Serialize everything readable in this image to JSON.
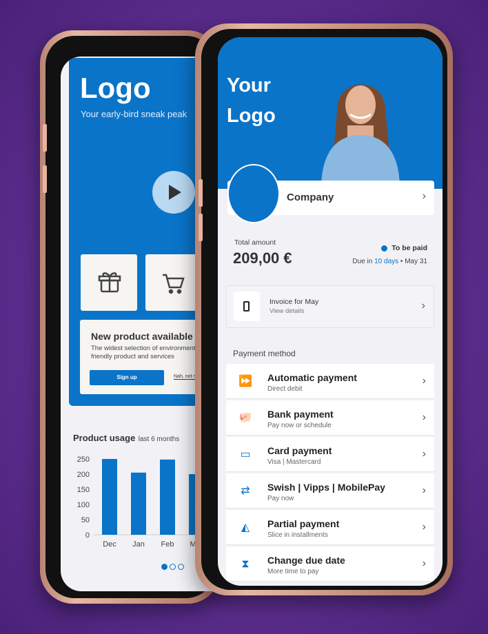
{
  "left_phone": {
    "logo": "Logo",
    "tagline": "Your early-bird sneak peak",
    "tiles": [
      {
        "icon": "gift-icon"
      },
      {
        "icon": "cart-icon"
      }
    ],
    "promo": {
      "title": "New product available",
      "body1": "The widest selection of environmentally",
      "body2": "friendly product and services",
      "primary": "Sign up",
      "secondary": "Nah, not now"
    },
    "usage_title": "Product usage",
    "usage_sub": "last 6 months",
    "pager": {
      "count": 3,
      "active": 0
    }
  },
  "chart_data": {
    "type": "bar",
    "title": "Product usage",
    "subtitle": "last 6 months",
    "categories": [
      "Dec",
      "Jan",
      "Feb",
      "Mar"
    ],
    "values": [
      250,
      205,
      248,
      200
    ],
    "ylim": [
      0,
      250
    ],
    "yticks": [
      250,
      200,
      150,
      100,
      50,
      0
    ],
    "grid": false,
    "color": "#0a74c9"
  },
  "right_phone": {
    "logo_line1": "Your",
    "logo_line2": "Logo",
    "company": "Company",
    "total_label": "Total amount",
    "total": "209,00 €",
    "status": "To be paid",
    "due_prefix": "Due in ",
    "due_days": "10 days",
    "due_suffix": " • May 31",
    "invoice": {
      "title": "Invoice for May",
      "sub": "View details"
    },
    "payment_title": "Payment method",
    "methods": [
      {
        "icon": "direct-debit-icon",
        "title": "Automatic payment",
        "sub": "Direct debit"
      },
      {
        "icon": "piggy-bank-icon",
        "title": "Bank payment",
        "sub": "Pay now or schedule"
      },
      {
        "icon": "credit-card-icon",
        "title": "Card payment",
        "sub": "Visa  |  Mastercard"
      },
      {
        "icon": "swap-icon",
        "title": "Swish | Vipps | MobilePay",
        "sub": "Pay now"
      },
      {
        "icon": "pizza-slice-icon",
        "title": "Partial payment",
        "sub": "Slice in installments"
      },
      {
        "icon": "hourglass-icon",
        "title": "Change due date",
        "sub": "More time to pay"
      }
    ]
  },
  "colors": {
    "brand": "#0a74c9",
    "background": "#5e2f91",
    "frame": "#d9a893"
  }
}
